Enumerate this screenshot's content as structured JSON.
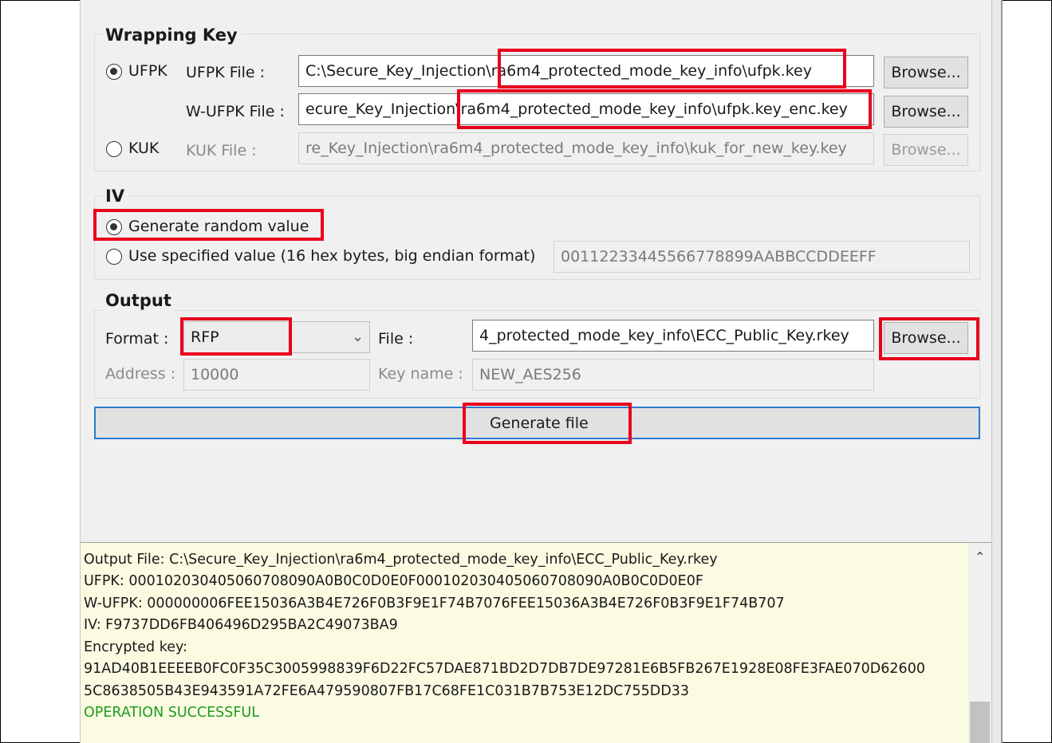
{
  "wrapping_key": {
    "legend": "Wrapping Key",
    "ufpk_radio_label": "UFPK",
    "ufpk_file_label": "UFPK File :",
    "ufpk_file_value_a": "C:\\Secure_Key_Injection\\",
    "ufpk_file_value_b": "ra6m4_protected_mode_key_info\\ufpk.key",
    "wufpk_file_label": "W-UFPK File :",
    "wufpk_file_value_a": "ecure_Key_Injection",
    "wufpk_file_value_b": "\\ra6m4_protected_mode_key_info\\ufpk.key_enc.key",
    "kuk_radio_label": "KUK",
    "kuk_file_label": "KUK File :",
    "kuk_file_value": "re_Key_Injection\\ra6m4_protected_mode_key_info\\kuk_for_new_key.key",
    "browse_label": "Browse..."
  },
  "iv": {
    "legend": "IV",
    "random_label": "Generate random value",
    "specified_label": "Use specified value (16 hex bytes, big endian format)",
    "specified_value": "00112233445566778899AABBCCDDEEFF"
  },
  "output": {
    "legend": "Output",
    "format_label": "Format :",
    "format_value": "RFP",
    "file_label": "File :",
    "file_value": "4_protected_mode_key_info\\ECC_Public_Key.rkey",
    "browse_label": "Browse...",
    "address_label": "Address :",
    "address_value": "10000",
    "keyname_label": "Key name :",
    "keyname_value": "NEW_AES256"
  },
  "generate_label": "Generate file",
  "log": {
    "line1": "Output File: C:\\Secure_Key_Injection\\ra6m4_protected_mode_key_info\\ECC_Public_Key.rkey",
    "line2": "UFPK: 000102030405060708090A0B0C0D0E0F000102030405060708090A0B0C0D0E0F",
    "line3": "W-UFPK: 000000006FEE15036A3B4E726F0B3F9E1F74B7076FEE15036A3B4E726F0B3F9E1F74B707",
    "line4": "IV: F9737DD6FB406496D295BA2C49073BA9",
    "line5": "Encrypted key:",
    "line6": "91AD40B1EEEEB0FC0F35C3005998839F6D22FC57DAE871BD2D7DB7DE97281E6B5FB267E1928E08FE3FAE070D62600",
    "line7": "5C8638505B43E943591A72FE6A479590807FB17C68FE1C031B7B753E12DC755DD33",
    "line8": "OPERATION SUCCESSFUL",
    "success_color": "#1f9a1f"
  },
  "colors": {
    "highlight": "#e8001c",
    "focus": "#2a7bd4"
  },
  "icons": {
    "dropdown": "chevron-down-icon",
    "scroll_up": "chevron-up-icon"
  }
}
